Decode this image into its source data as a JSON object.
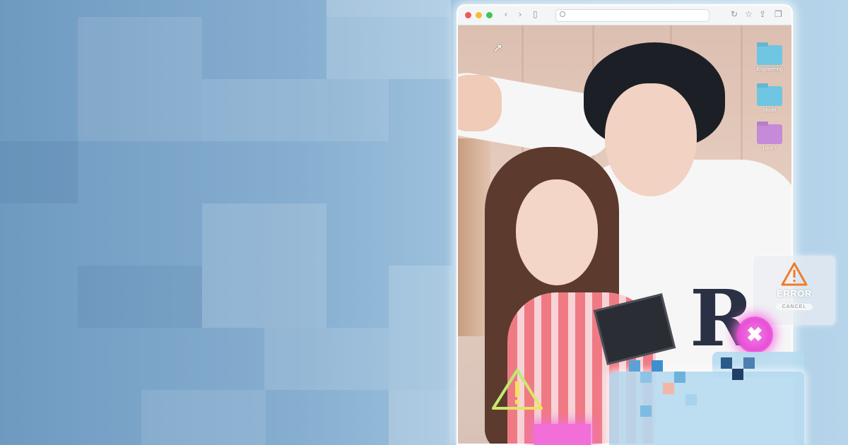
{
  "browser": {
    "url_placeholder": "",
    "nav": {
      "back": "‹",
      "forward": "›",
      "sidebar": "▯",
      "reload": "↻",
      "star": "☆",
      "share": "⇪",
      "tabs": "❐"
    }
  },
  "desktop": {
    "items": [
      {
        "label": "Engineering",
        "color": "#6fc6e2"
      },
      {
        "label": "Model",
        "color": "#6fc6e2"
      },
      {
        "label": "Love?",
        "color": "#c58ad8"
      }
    ]
  },
  "hoodie_text": "R",
  "error_dialog": {
    "title": "ERROR",
    "cancel_label": "CANCEL",
    "icon": "warning-icon",
    "accent": "#f07b2b"
  },
  "close_glyph": "✖",
  "colors": {
    "background": "#86aed0",
    "accent_pink": "#e850d6",
    "warning_green": "#9ef07c",
    "warning_yellow": "#f2e35c"
  }
}
